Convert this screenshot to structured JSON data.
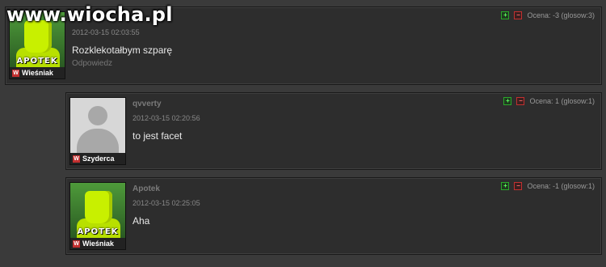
{
  "site": {
    "watermark": "www.wiocha.pl"
  },
  "ui": {
    "vote_up_glyph": "+",
    "vote_down_glyph": "−"
  },
  "comments": [
    {
      "author": "",
      "date": "2012-03-15 02:03:55",
      "text": "Rozklekotałbym szparę",
      "reply": "Odpowiedz",
      "rating": "Ocena: -3 (glosow:3)",
      "avatar_logo": "APOTEK",
      "rank": "Wieśniak",
      "avatar_icon": "lime-character-avatar"
    },
    {
      "author": "qvverty",
      "date": "2012-03-15 02:20:56",
      "text": "to jest facet",
      "reply": "",
      "rating": "Ocena: 1 (glosow:1)",
      "avatar_logo": "",
      "rank": "Szyderca",
      "avatar_icon": "default-user-avatar"
    },
    {
      "author": "Apotek",
      "date": "2012-03-15 02:25:05",
      "text": "Aha",
      "reply": "",
      "rating": "Ocena: -1 (glosow:1)",
      "avatar_logo": "APOTEK",
      "rank": "Wieśniak",
      "avatar_icon": "lime-character-avatar"
    }
  ],
  "colors": {
    "up": "#2aa82a",
    "down": "#c23030",
    "panel": "#2d2d2d",
    "background": "#3a3a3a"
  }
}
